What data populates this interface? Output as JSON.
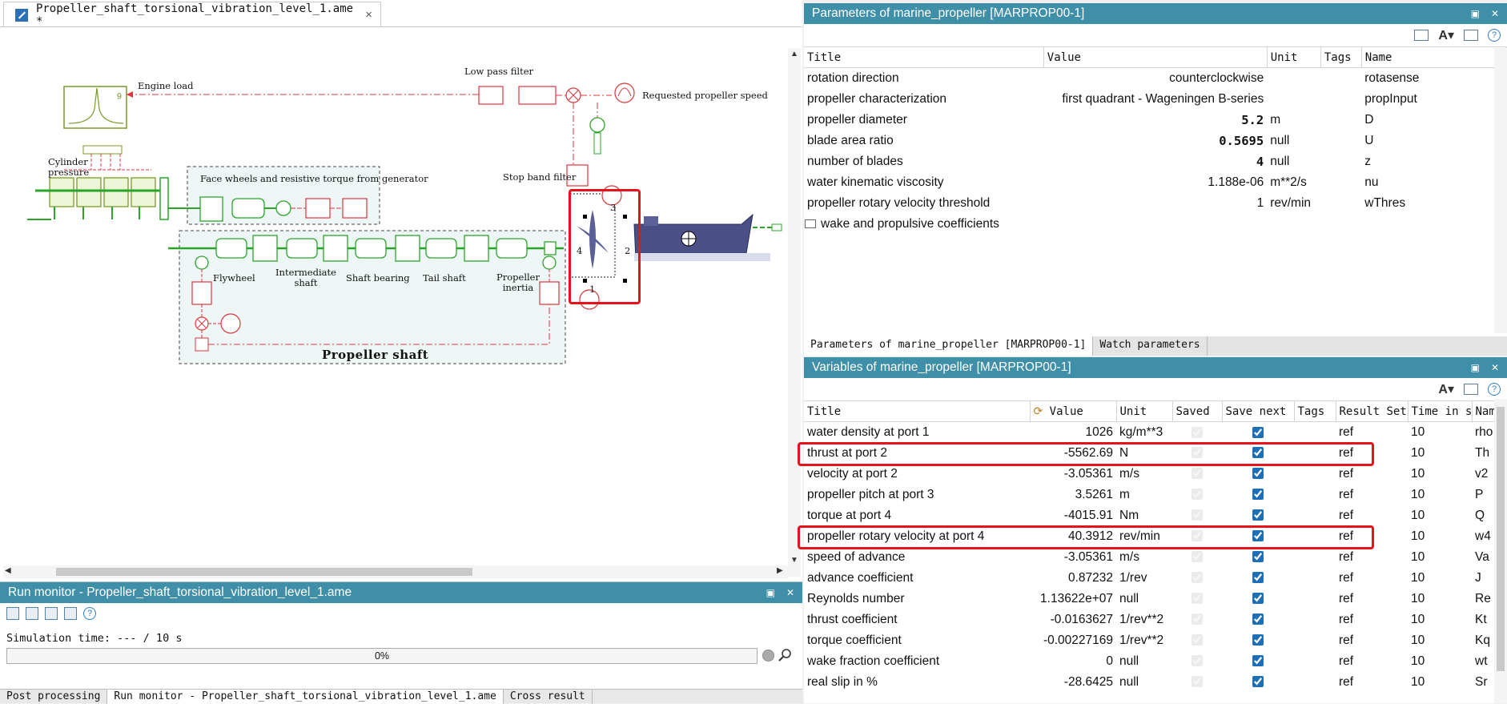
{
  "editor": {
    "tab_title": "Propeller_shaft_torsional_vibration_level_1.ame *",
    "close_glyph": "×",
    "labels": {
      "engine_load": "Engine load",
      "low_pass_filter": "Low pass filter",
      "requested_speed": "Requested propeller speed",
      "cylinder_pressure": "Cylinder\npressure",
      "face_wheels": "Face wheels and resistive torque from generator",
      "stop_band": "Stop band filter",
      "flywheel": "Flywheel",
      "intermediate_shaft": "Intermediate\nshaft",
      "shaft_bearing": "Shaft bearing",
      "tail_shaft": "Tail shaft",
      "propeller_inertia": "Propeller\ninertia",
      "propeller_shaft": "Propeller shaft",
      "port1": "1",
      "port2": "2",
      "port3": "3",
      "port4": "4"
    }
  },
  "run_monitor": {
    "title": "Run monitor - Propeller_shaft_torsional_vibration_level_1.ame",
    "sim_time": "Simulation time: --- / 10 s",
    "progress_text": "0%",
    "progress_value": 0
  },
  "bottom_tabs": [
    "Post processing",
    "Run monitor - Propeller_shaft_torsional_vibration_level_1.ame",
    "Cross result"
  ],
  "params": {
    "title": "Parameters of marine_propeller [MARPROP00-1]",
    "columns": [
      "Title",
      "Value",
      "Unit",
      "Tags",
      "Name"
    ],
    "rows": [
      {
        "title": "rotation direction",
        "value": "counterclockwise",
        "unit": "",
        "tags": "",
        "name": "rotasense",
        "bold": false
      },
      {
        "title": "propeller characterization",
        "value": "first quadrant - Wageningen B-series",
        "unit": "",
        "tags": "",
        "name": "propInput",
        "bold": false
      },
      {
        "title": "propeller diameter",
        "value": "5.2",
        "unit": "m",
        "tags": "",
        "name": "D",
        "bold": true
      },
      {
        "title": "blade area ratio",
        "value": "0.5695",
        "unit": "null",
        "tags": "",
        "name": "U",
        "bold": true
      },
      {
        "title": "number of blades",
        "value": "4",
        "unit": "null",
        "tags": "",
        "name": "z",
        "bold": true
      },
      {
        "title": "water kinematic viscosity",
        "value": "1.188e-06",
        "unit": "m**2/s",
        "tags": "",
        "name": "nu",
        "bold": false
      },
      {
        "title": "propeller rotary velocity threshold",
        "value": "1",
        "unit": "rev/min",
        "tags": "",
        "name": "wThres",
        "bold": false
      }
    ],
    "group": "wake and propulsive coefficients",
    "tabs": [
      "Parameters of marine_propeller [MARPROP00-1]",
      "Watch parameters"
    ]
  },
  "vars": {
    "title": "Variables of marine_propeller [MARPROP00-1]",
    "columns": [
      "Title",
      "Value",
      "Unit",
      "Saved",
      "Save next",
      "Tags",
      "Result Set",
      "Time in s",
      "Nam"
    ],
    "rows": [
      {
        "title": "water density at port 1",
        "value": "1026",
        "unit": "kg/m**3",
        "set": "ref",
        "time": "10",
        "name": "rho"
      },
      {
        "title": "thrust at port 2",
        "value": "-5562.69",
        "unit": "N",
        "set": "ref",
        "time": "10",
        "name": "Th"
      },
      {
        "title": "velocity at port 2",
        "value": "-3.05361",
        "unit": "m/s",
        "set": "ref",
        "time": "10",
        "name": "v2"
      },
      {
        "title": "propeller pitch at port 3",
        "value": "3.5261",
        "unit": "m",
        "set": "ref",
        "time": "10",
        "name": "P"
      },
      {
        "title": "torque at port 4",
        "value": "-4015.91",
        "unit": "Nm",
        "set": "ref",
        "time": "10",
        "name": "Q"
      },
      {
        "title": "propeller rotary velocity at port 4",
        "value": "40.3912",
        "unit": "rev/min",
        "set": "ref",
        "time": "10",
        "name": "w4"
      },
      {
        "title": "speed of advance",
        "value": "-3.05361",
        "unit": "m/s",
        "set": "ref",
        "time": "10",
        "name": "Va"
      },
      {
        "title": "advance coefficient",
        "value": "0.87232",
        "unit": "1/rev",
        "set": "ref",
        "time": "10",
        "name": "J"
      },
      {
        "title": "Reynolds number",
        "value": "1.13622e+07",
        "unit": "null",
        "set": "ref",
        "time": "10",
        "name": "Re"
      },
      {
        "title": "thrust coefficient",
        "value": "-0.0163627",
        "unit": "1/rev**2",
        "set": "ref",
        "time": "10",
        "name": "Kt"
      },
      {
        "title": "torque coefficient",
        "value": "-0.00227169",
        "unit": "1/rev**2",
        "set": "ref",
        "time": "10",
        "name": "Kq"
      },
      {
        "title": "wake fraction coefficient",
        "value": "0",
        "unit": "null",
        "set": "ref",
        "time": "10",
        "name": "wt"
      },
      {
        "title": "real slip in %",
        "value": "-28.6425",
        "unit": "null",
        "set": "ref",
        "time": "10",
        "name": "Sr"
      }
    ]
  },
  "colors": {
    "panel_header": "#3f8fa8",
    "highlight": "#e8121b",
    "green": "#2aa52a",
    "red": "#d9363e",
    "olive": "#7a9a2a"
  }
}
